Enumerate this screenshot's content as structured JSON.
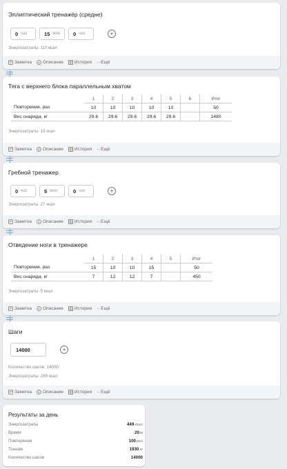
{
  "footer": {
    "note": "Заметка",
    "description": "Описание",
    "history": "История",
    "more": "Ещё"
  },
  "cards": [
    {
      "title": "Эллиптический тренажёр (средне)",
      "time": {
        "hours": "0",
        "hours_unit": "час",
        "minutes": "15",
        "minutes_unit": "мин",
        "seconds": "0",
        "seconds_unit": "сек"
      },
      "energy": "Энергозатраты: 110 ккал"
    },
    {
      "title": "Тяга с верхнего блока параллельным хватом",
      "set_headers": [
        "1",
        "2",
        "3",
        "4",
        "5",
        "6"
      ],
      "total_header": "Итог",
      "rows": [
        {
          "label": "Повторения, раз",
          "values": [
            "10",
            "10",
            "10",
            "10",
            "10",
            ""
          ],
          "total": "50"
        },
        {
          "label": "Вес снаряда, кг",
          "values": [
            "29.6",
            "29.6",
            "29.6",
            "29.6",
            "29.6",
            ""
          ],
          "total": "1480"
        }
      ],
      "energy": "Энергозатраты: 18 ккал"
    },
    {
      "title": "Гребной тренажер",
      "time": {
        "hours": "0",
        "hours_unit": "час",
        "minutes": "5",
        "minutes_unit": "мин",
        "seconds": "0",
        "seconds_unit": "сек"
      },
      "energy": "Энергозатраты: 27 ккал"
    },
    {
      "title": "Отведение ноги в тренажере",
      "set_headers": [
        "1",
        "2",
        "3",
        "4",
        "5"
      ],
      "total_header": "Итог",
      "rows": [
        {
          "label": "Повторения, раз",
          "values": [
            "15",
            "10",
            "10",
            "15",
            ""
          ],
          "total": "50"
        },
        {
          "label": "Вес снаряда, кг",
          "values": [
            "7",
            "12",
            "12",
            "7",
            ""
          ],
          "total": "450"
        }
      ],
      "energy": "Энергозатраты: 5 ккал"
    },
    {
      "title": "Шаги",
      "steps_value": "14000",
      "steps_count": "Количество шагов: 14000",
      "energy": "Энергозатраты: 289 ккал"
    }
  ],
  "summary": {
    "title": "Результаты за день",
    "rows": [
      {
        "label": "Энергозатраты",
        "value": "449",
        "unit": "ккал"
      },
      {
        "label": "Время",
        "value": "20",
        "unit": "м"
      },
      {
        "label": "Повторения",
        "value": "100",
        "unit": "раз"
      },
      {
        "label": "Тоннаж",
        "value": "1930",
        "unit": "кг"
      },
      {
        "label": "Количество шагов",
        "value": "14000",
        "unit": ""
      }
    ]
  },
  "colors": {
    "background": "#e9ebee",
    "card": "#ffffff",
    "footer": "#f3f4f6",
    "drag_handle": "#7ea4d6"
  }
}
